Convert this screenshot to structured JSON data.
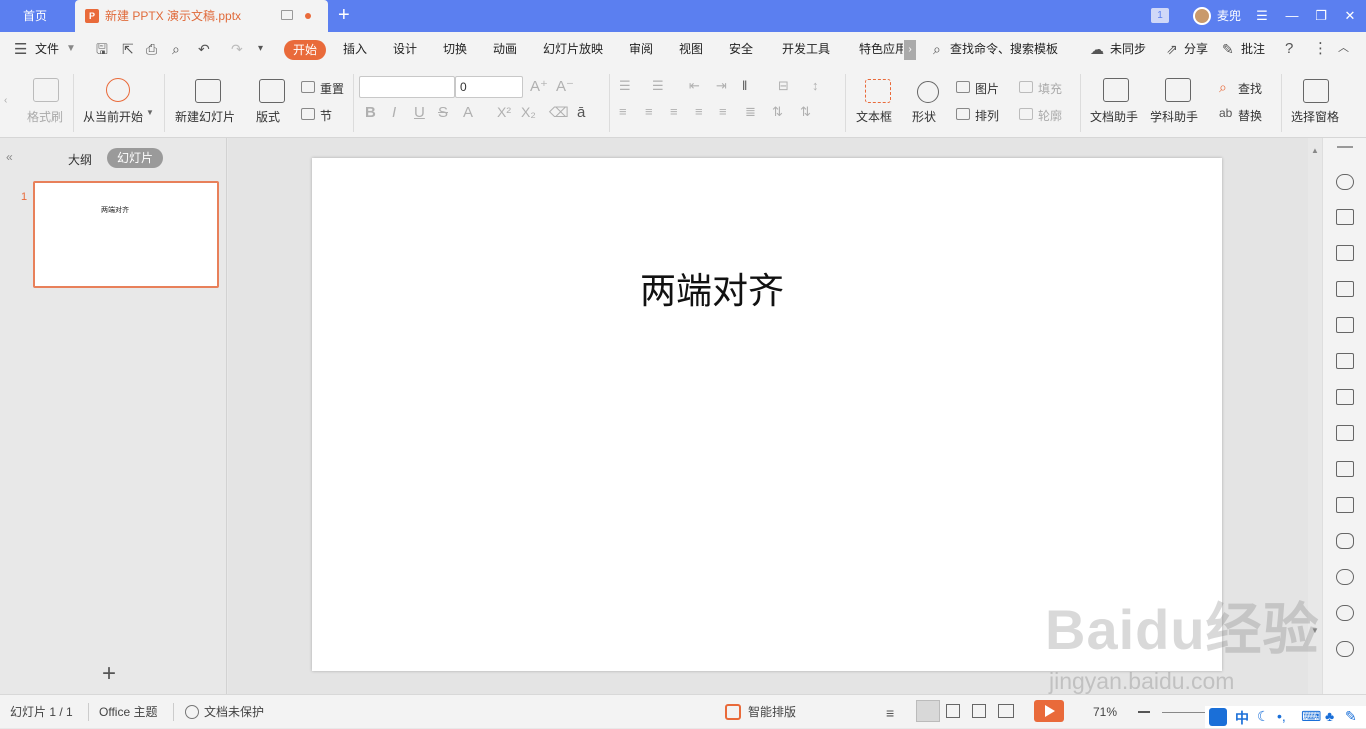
{
  "titlebar": {
    "home_tab": "首页",
    "doc_tab_title": "新建 PPTX 演示文稿.pptx",
    "new_tab": "+",
    "window_count_badge": "1",
    "username": "麦兜"
  },
  "menu": {
    "file": "文件",
    "tabs": [
      "开始",
      "插入",
      "设计",
      "切换",
      "动画",
      "幻灯片放映",
      "审阅",
      "视图",
      "安全",
      "开发工具",
      "特色应用"
    ],
    "search": "查找命令、搜索模板",
    "sync": "未同步",
    "share": "分享",
    "comment": "批注"
  },
  "ribbon": {
    "format_painter": "格式刷",
    "play_from_current": "从当前开始",
    "new_slide": "新建幻灯片",
    "layout": "版式",
    "reset": "重置",
    "section": "节",
    "font_size_value": "0",
    "text_box": "文本框",
    "shape": "形状",
    "picture": "图片",
    "arrange": "排列",
    "fill": "填充",
    "outline": "轮廓",
    "doc_assistant": "文档助手",
    "subject_assistant": "学科助手",
    "find": "查找",
    "replace": "替换",
    "selection_pane": "选择窗格"
  },
  "leftpane": {
    "outline_tab": "大纲",
    "slides_tab": "幻灯片",
    "thumb_number": "1",
    "thumb_text": "两端对齐"
  },
  "slide": {
    "title_text": "两端对齐"
  },
  "statusbar": {
    "slide_counter": "幻灯片 1 / 1",
    "theme": "Office 主题",
    "protection": "文档未保护",
    "smart_layout": "智能排版",
    "zoom": "71%"
  },
  "watermark": {
    "brand": "Baidu经验",
    "url": "jingyan.baidu.com"
  },
  "colors": {
    "accent": "#e96a3a",
    "titlebar": "#5b7ff0"
  }
}
